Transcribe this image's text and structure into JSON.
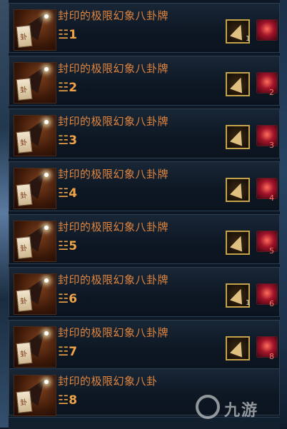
{
  "items": [
    {
      "name": "封印的极限幻象八卦牌",
      "grade": "☳1",
      "slot_num": "1",
      "gem_num": ""
    },
    {
      "name": "封印的极限幻象八卦牌",
      "grade": "☳2",
      "slot_num": "",
      "gem_num": "2"
    },
    {
      "name": "封印的极限幻象八卦牌",
      "grade": "☳3",
      "slot_num": "",
      "gem_num": "3"
    },
    {
      "name": "封印的极限幻象八卦牌",
      "grade": "☳4",
      "slot_num": "",
      "gem_num": "4"
    },
    {
      "name": "封印的极限幻象八卦牌",
      "grade": "☳5",
      "slot_num": "",
      "gem_num": "5"
    },
    {
      "name": "封印的极限幻象八卦牌",
      "grade": "☳6",
      "slot_num": "1",
      "gem_num": "6"
    },
    {
      "name": "封印的极限幻象八卦牌",
      "grade": "☳7",
      "slot_num": "",
      "gem_num": "8"
    },
    {
      "name": "封印的极限幻象八卦",
      "grade": "☳8",
      "slot_num": "",
      "gem_num": ""
    }
  ],
  "watermark": {
    "text": "九游"
  }
}
